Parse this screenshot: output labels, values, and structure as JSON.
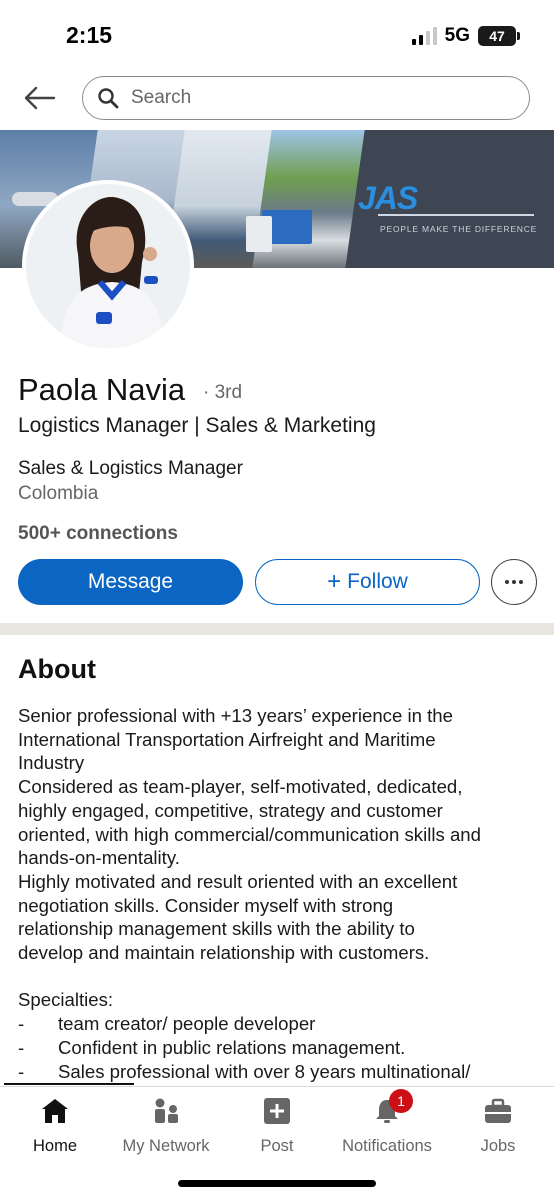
{
  "status_bar": {
    "time": "2:15",
    "network": "5G",
    "battery": "47"
  },
  "header": {
    "search_placeholder": "Search"
  },
  "banner": {
    "logo_text": "JAS",
    "tagline": "PEOPLE MAKE THE DIFFERENCE"
  },
  "profile": {
    "name": "Paola Navia",
    "degree": "· 3rd",
    "headline": "Logistics Manager | Sales & Marketing",
    "current_role": "Sales & Logistics Manager",
    "location": "Colombia",
    "connections": "500+ connections"
  },
  "actions": {
    "message_label": "Message",
    "follow_label": "Follow",
    "follow_icon": "+"
  },
  "about": {
    "title": "About",
    "lines": [
      "Senior professional with +13 years’ experience in the",
      "International Transportation Airfreight and Maritime",
      "Industry",
      "Considered as team-player, self-motivated, dedicated,",
      "highly engaged, competitive, strategy and customer",
      "oriented, with high commercial/communication skills and",
      "hands-on-mentality.",
      "Highly motivated and result oriented with an excellent",
      "negotiation skills. Consider myself with strong",
      "relationship management skills with the ability to",
      "develop and maintain relationship with customers."
    ],
    "specialties_title": "Specialties:",
    "specialties": [
      "team creator/ people developer",
      "Confident in public relations management.",
      "Sales professional with over 8 years multinational/"
    ],
    "bullet_dash": "-"
  },
  "bottom_nav": {
    "items": [
      {
        "label": "Home",
        "icon": "home-icon",
        "active": true
      },
      {
        "label": "My Network",
        "icon": "network-icon",
        "active": false
      },
      {
        "label": "Post",
        "icon": "post-icon",
        "active": false
      },
      {
        "label": "Notifications",
        "icon": "bell-icon",
        "active": false,
        "badge": "1"
      },
      {
        "label": "Jobs",
        "icon": "briefcase-icon",
        "active": false
      }
    ]
  },
  "colors": {
    "primary_blue": "#0a66c2",
    "badge_red": "#cc1016",
    "logo_blue": "#2a8fe0"
  }
}
